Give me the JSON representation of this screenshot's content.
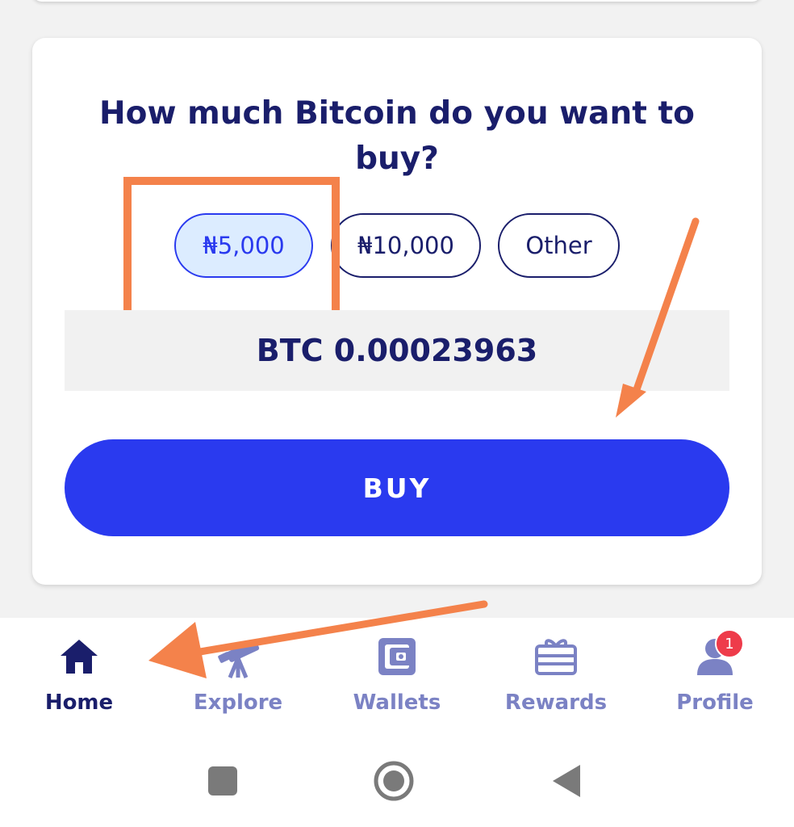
{
  "card": {
    "title": "How much Bitcoin do you want to buy?",
    "amount_options": [
      {
        "label": "₦5,000",
        "selected": true
      },
      {
        "label": "₦10,000",
        "selected": false
      },
      {
        "label": "Other",
        "selected": false
      }
    ],
    "btc_amount": "BTC 0.00023963",
    "buy_label": "BUY"
  },
  "bottom_nav": {
    "items": [
      {
        "label": "Home",
        "icon": "home-icon",
        "active": true
      },
      {
        "label": "Explore",
        "icon": "telescope-icon",
        "active": false
      },
      {
        "label": "Wallets",
        "icon": "wallet-icon",
        "active": false
      },
      {
        "label": "Rewards",
        "icon": "gift-card-icon",
        "active": false
      },
      {
        "label": "Profile",
        "icon": "user-icon",
        "active": false,
        "badge": "1"
      }
    ]
  },
  "colors": {
    "primary": "#2a3aef",
    "navy": "#1a1e6b",
    "inactive_nav": "#7b82c4",
    "selected_chip_bg": "#dcecff",
    "annotation": "#f4824b",
    "badge": "#ee3b4a"
  }
}
